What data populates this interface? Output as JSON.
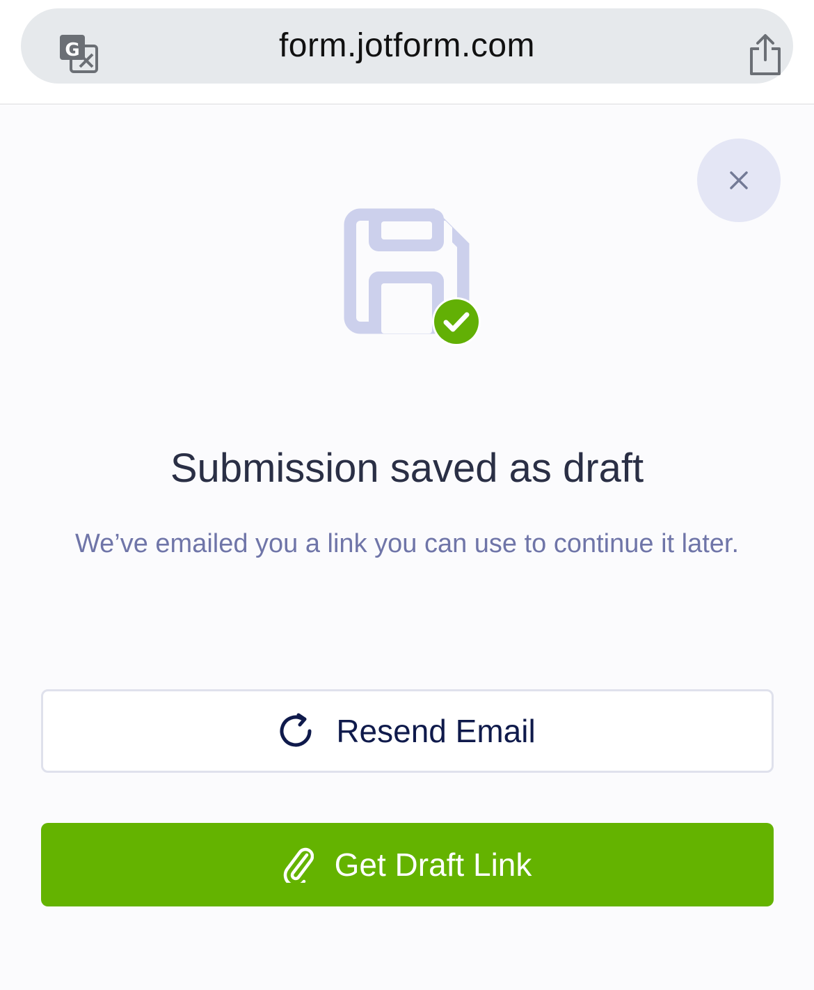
{
  "browser": {
    "url": "form.jotform.com",
    "icons": [
      "translate-icon",
      "share-icon"
    ]
  },
  "dialog": {
    "close_icon": "close-icon",
    "illustration_icon": "floppy-disk-icon",
    "status_icon": "check-icon",
    "title": "Submission saved as draft",
    "message": "We’ve emailed you a link you can use to continue it later.",
    "resend_button": {
      "label": "Resend Email",
      "icon": "refresh-icon"
    },
    "draft_link_button": {
      "label": "Get Draft Link",
      "icon": "paperclip-icon"
    }
  },
  "colors": {
    "accent_green": "#64b300",
    "illustration": "#ccd0ec",
    "title": "#2a2f45",
    "subtitle": "#6f75a8",
    "resend_label": "#0f1a4b"
  }
}
